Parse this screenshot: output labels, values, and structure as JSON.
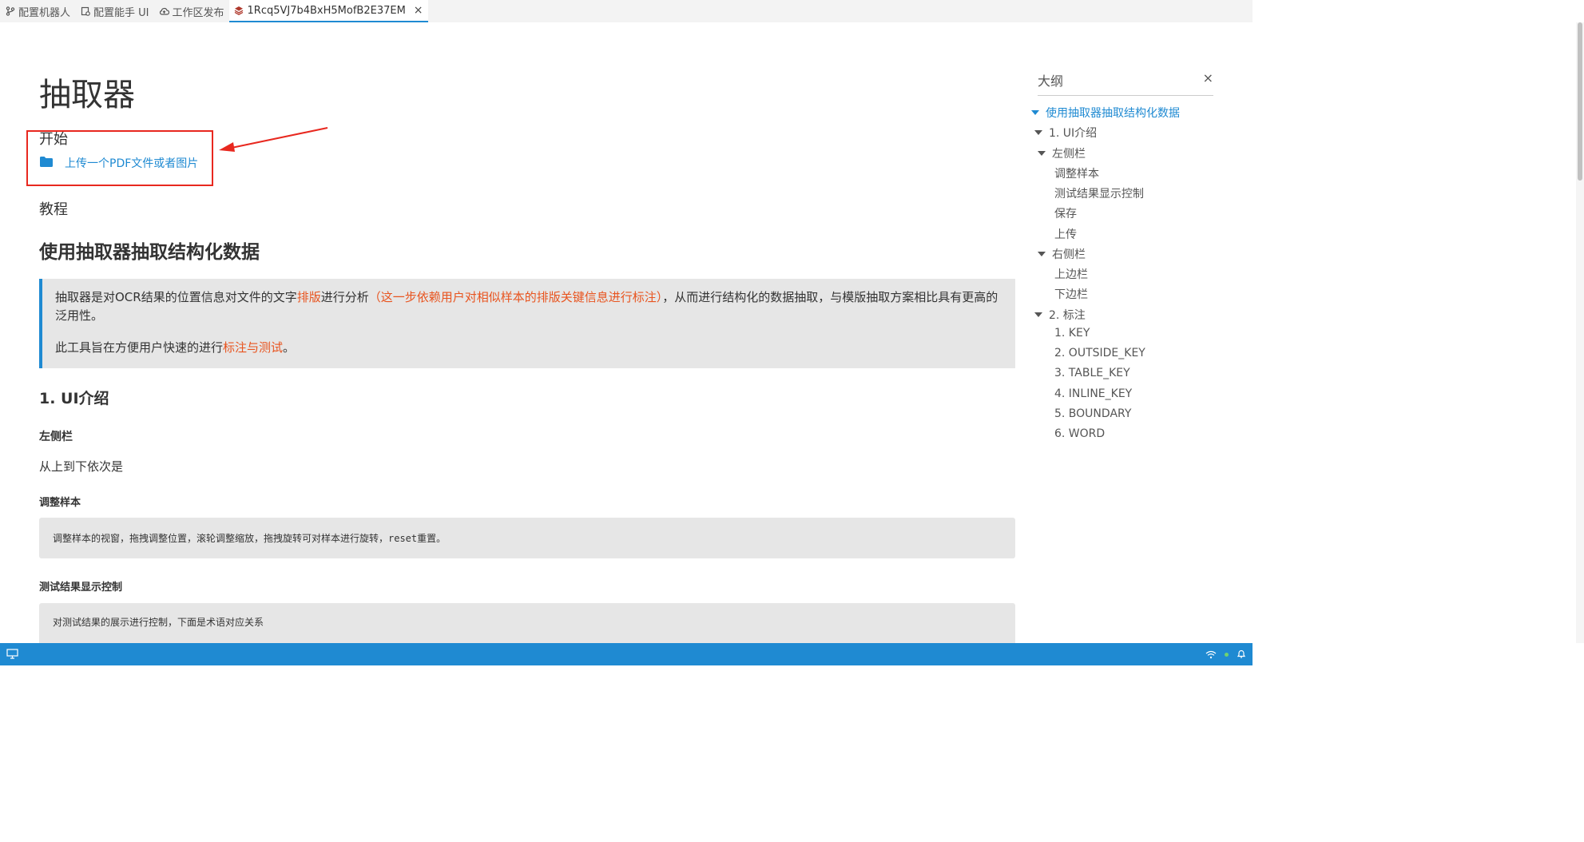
{
  "tabs": [
    {
      "label": "配置机器人",
      "icon": "branch-icon"
    },
    {
      "label": "配置能手 UI",
      "icon": "settings-doc-icon"
    },
    {
      "label": "工作区发布",
      "icon": "cloud-upload-icon"
    },
    {
      "label": "1Rcq5VJ7b4BxH5MofB2E37EM",
      "icon": "stack-icon",
      "active": true,
      "close": "×"
    }
  ],
  "main": {
    "title": "抽取器",
    "start_label": "开始",
    "upload_link": "上传一个PDF文件或者图片",
    "tutorial_label": "教程",
    "section_title": "使用抽取器抽取结构化数据",
    "callout": {
      "p1_a": "抽取器是对OCR结果的位置信息对文件的文字",
      "p1_b": "排版",
      "p1_c": "进行分析",
      "p1_d": "（这一步依赖用户对相似样本的排版关键信息进行标注）",
      "p1_e": "，从而进行结构化的数据抽取，与模版抽取方案相比具有更高的泛用性。",
      "p2_a": "此工具旨在方便用户快速的进行",
      "p2_b": "标注与测试",
      "p2_c": "。"
    },
    "ui_title": "1. UI介绍",
    "left_sidebar_title": "左侧栏",
    "order_text": "从上到下依次是",
    "adjust_title": "调整样本",
    "adjust_code": "调整样本的视窗，拖拽调整位置，滚轮调整缩放，拖拽旋转可对样本进行旋转，reset重置。",
    "test_title": "测试结果显示控制",
    "test_code": "对测试结果的展示进行控制，下面是术语对应关系"
  },
  "outline": {
    "title": "大纲",
    "close": "×",
    "items": [
      {
        "label": "使用抽取器抽取结构化数据",
        "level": 0,
        "expanded": true,
        "active": true
      },
      {
        "label": "1. UI介绍",
        "level": 1,
        "expanded": true
      },
      {
        "label": "左侧栏",
        "level": 2,
        "expanded": true
      },
      {
        "label": "调整样本",
        "level": 3
      },
      {
        "label": "测试结果显示控制",
        "level": 3
      },
      {
        "label": "保存",
        "level": 3
      },
      {
        "label": "上传",
        "level": 3
      },
      {
        "label": "右侧栏",
        "level": 2,
        "expanded": true
      },
      {
        "label": "上边栏",
        "level": 3
      },
      {
        "label": "下边栏",
        "level": 3
      },
      {
        "label": "2. 标注",
        "level": 1,
        "expanded": true
      },
      {
        "label": "1. KEY",
        "level": 3
      },
      {
        "label": "2. OUTSIDE_KEY",
        "level": 3
      },
      {
        "label": "3. TABLE_KEY",
        "level": 3
      },
      {
        "label": "4. INLINE_KEY",
        "level": 3
      },
      {
        "label": "5. BOUNDARY",
        "level": 3
      },
      {
        "label": "6. WORD",
        "level": 3
      }
    ]
  },
  "colors": {
    "accent": "#1f8ad2",
    "highlight": "#e8541f",
    "annotation": "#e8281f",
    "statusbar": "#1f8ad2"
  }
}
